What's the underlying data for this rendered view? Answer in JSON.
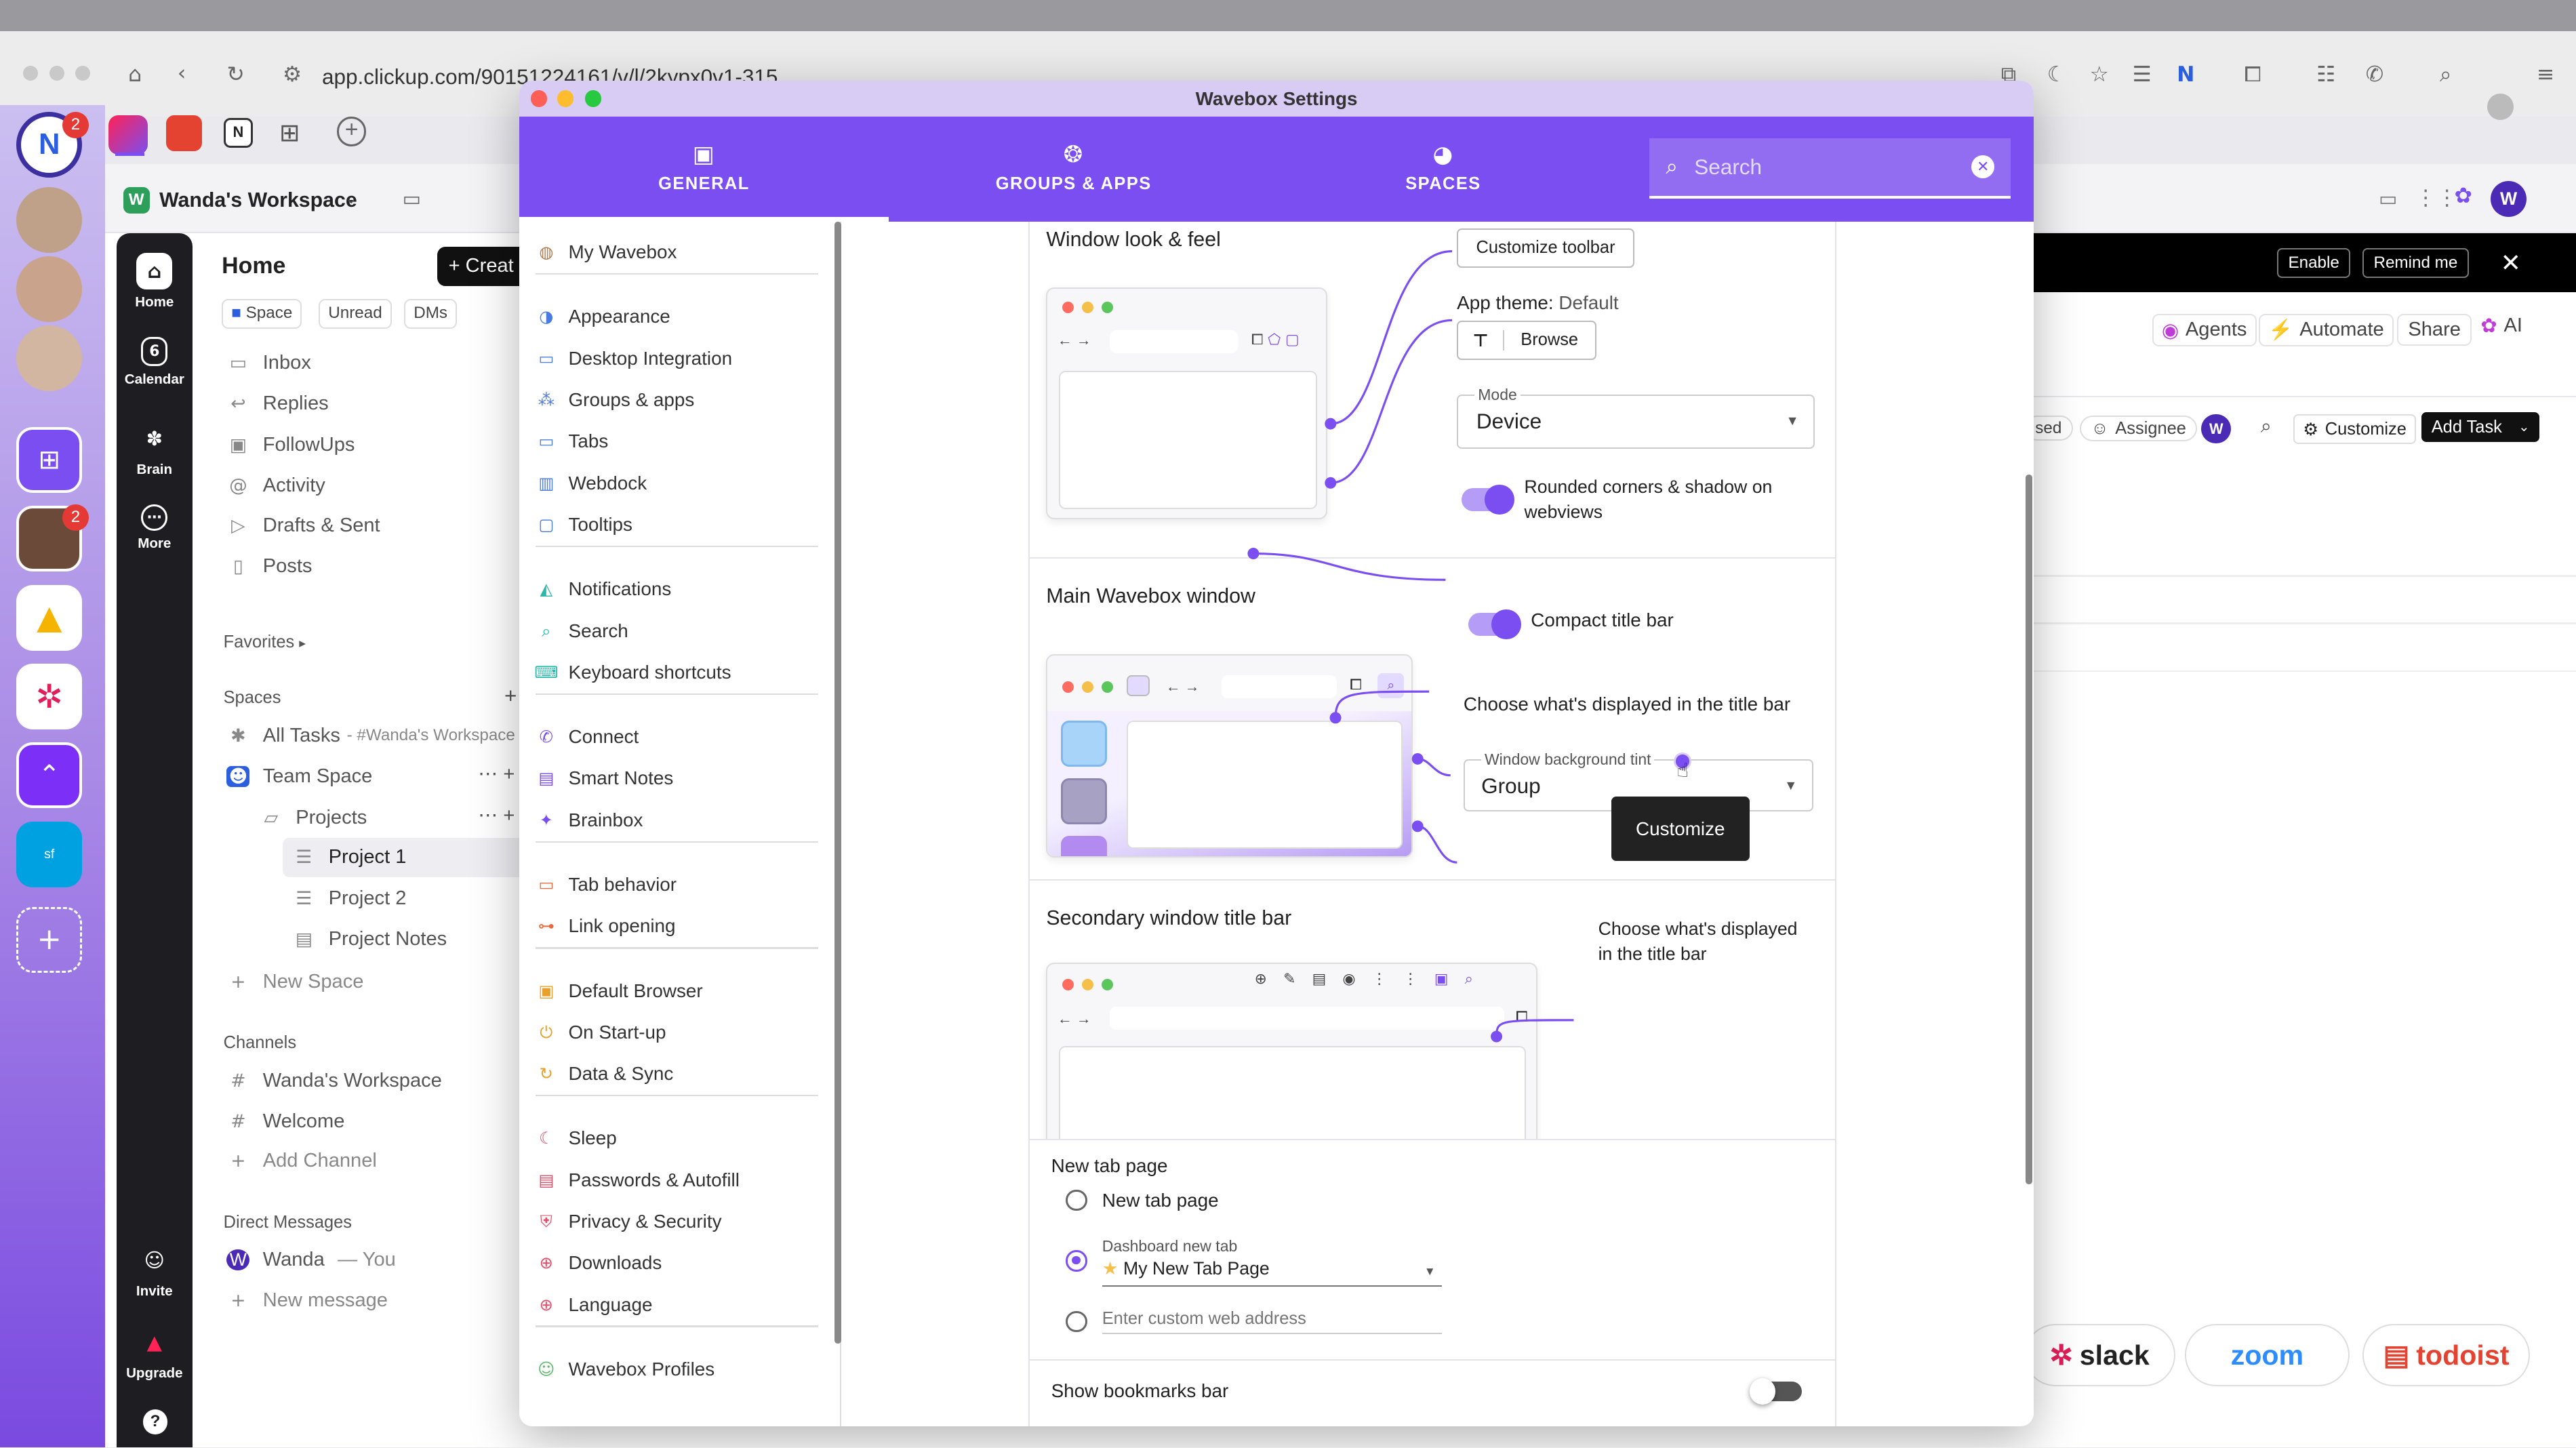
{
  "browser": {
    "url": "app.clickup.com/90151224161/v/l/2kypx0v1-315"
  },
  "apps_bar": {
    "notion_badge": "2",
    "avatar_badge": "2"
  },
  "clickup": {
    "workspace_name": "Wanda's Workspace",
    "nav": [
      "Home",
      "Calendar",
      "Brain",
      "More",
      "Invite",
      "Upgrade"
    ],
    "calendar_day": "6",
    "sidebar_title": "Home",
    "create_label": "+ Creat",
    "filters": [
      "Space",
      "Unread",
      "DMs"
    ],
    "home_items": [
      "Inbox",
      "Replies",
      "FollowUps",
      "Activity",
      "Drafts & Sent",
      "Posts"
    ],
    "favorites_label": "Favorites",
    "spaces_label": "Spaces",
    "all_tasks": "All Tasks",
    "all_tasks_suffix": "- #Wanda's Workspace",
    "team_space": "Team Space",
    "projects": "Projects",
    "project_items": [
      "Project 1",
      "Project 2",
      "Project Notes"
    ],
    "new_space": "New Space",
    "channels_label": "Channels",
    "channels": [
      "Wanda's Workspace",
      "Welcome"
    ],
    "add_channel": "Add Channel",
    "dm_label": "Direct Messages",
    "dm_user": "Wanda",
    "dm_you": "— You",
    "new_message": "New message"
  },
  "right_panel": {
    "enable": "Enable",
    "remind_me": "Remind me",
    "agents": "Agents",
    "automate": "Automate",
    "share": "Share",
    "ai": "AI",
    "sed": "sed",
    "assignee": "Assignee",
    "avatar_letter": "W",
    "customize": "Customize",
    "add_task": "Add Task",
    "logos": [
      "slack",
      "zoom",
      "todoist"
    ]
  },
  "settings": {
    "window_title": "Wavebox Settings",
    "tabs": [
      "GENERAL",
      "GROUPS & APPS",
      "SPACES"
    ],
    "search_placeholder": "Search",
    "menu_groups": [
      [
        "My Wavebox"
      ],
      [
        "Appearance",
        "Desktop Integration",
        "Groups & apps",
        "Tabs",
        "Webdock",
        "Tooltips"
      ],
      [
        "Notifications",
        "Search",
        "Keyboard shortcuts"
      ],
      [
        "Connect",
        "Smart Notes",
        "Brainbox"
      ],
      [
        "Tab behavior",
        "Link opening"
      ],
      [
        "Default Browser",
        "On Start-up",
        "Data & Sync"
      ],
      [
        "Sleep",
        "Passwords & Autofill",
        "Privacy & Security",
        "Downloads",
        "Language"
      ],
      [
        "Wavebox Profiles"
      ]
    ],
    "look_feel": {
      "title": "Window look & feel",
      "customize_toolbar": "Customize toolbar",
      "app_theme_label": "App theme:",
      "app_theme_value": "Default",
      "browse": "Browse",
      "mode_label": "Mode",
      "mode_value": "Device",
      "rounded_corners": "Rounded corners & shadow on webviews"
    },
    "main_window": {
      "title": "Main Wavebox window",
      "compact_title_bar": "Compact title bar",
      "choose_title_bar": "Choose what's displayed in the title bar",
      "bg_tint_label": "Window background tint",
      "bg_tint_value": "Group",
      "tooltip": "Customize"
    },
    "secondary_window": {
      "title": "Secondary window title bar",
      "choose_title_bar": "Choose what's displayed in the title bar"
    },
    "new_tab": {
      "title": "New tab page",
      "option1": "New tab page",
      "dashboard_label": "Dashboard new tab",
      "dashboard_value": "My New Tab Page",
      "custom_placeholder": "Enter custom web address"
    },
    "bookmarks_bar": "Show bookmarks bar"
  }
}
